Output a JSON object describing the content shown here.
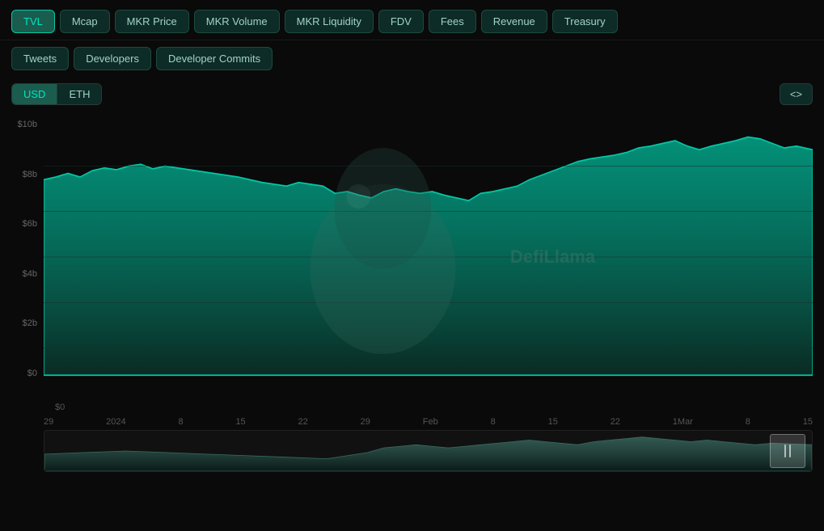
{
  "nav": {
    "primary": [
      {
        "label": "TVL",
        "active": true
      },
      {
        "label": "Mcap",
        "active": false
      },
      {
        "label": "MKR Price",
        "active": false
      },
      {
        "label": "MKR Volume",
        "active": false
      },
      {
        "label": "MKR Liquidity",
        "active": false
      },
      {
        "label": "FDV",
        "active": false
      },
      {
        "label": "Fees",
        "active": false
      },
      {
        "label": "Revenue",
        "active": false
      },
      {
        "label": "Treasury",
        "active": false
      }
    ],
    "secondary": [
      {
        "label": "Tweets",
        "active": false
      },
      {
        "label": "Developers",
        "active": false
      },
      {
        "label": "Developer Commits",
        "active": false
      }
    ]
  },
  "currency": {
    "options": [
      {
        "label": "USD",
        "active": true
      },
      {
        "label": "ETH",
        "active": false
      }
    ]
  },
  "embed_label": "<>",
  "watermark": "DefiLlama",
  "chart": {
    "y_labels": [
      "$10b",
      "$8b",
      "$6b",
      "$4b",
      "$2b",
      "$0"
    ],
    "x_labels": [
      "29",
      "2024",
      "8",
      "15",
      "22",
      "29",
      "Feb",
      "8",
      "15",
      "22",
      "1Mar",
      "8",
      "15"
    ]
  }
}
